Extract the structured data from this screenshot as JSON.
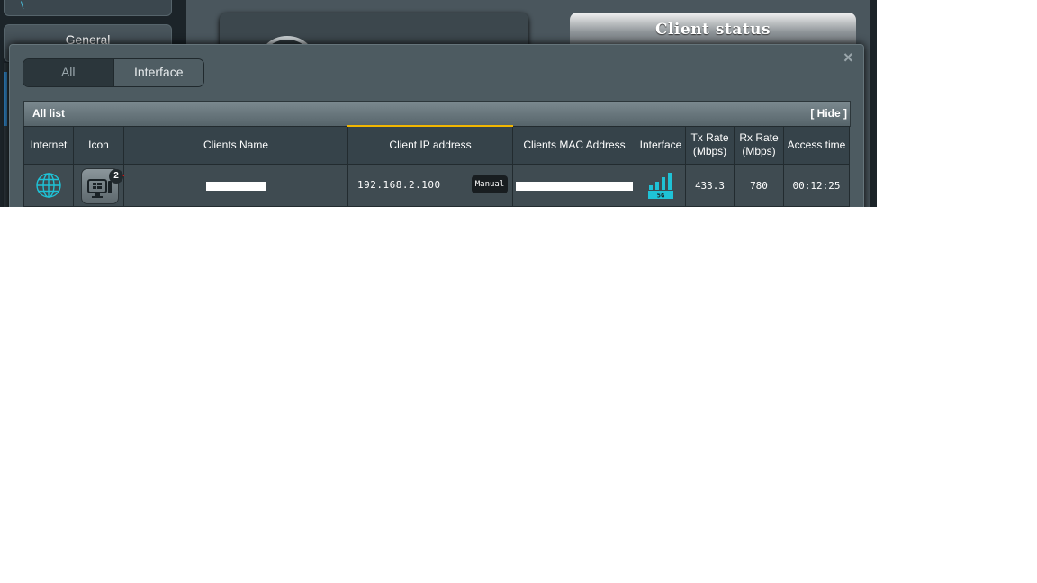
{
  "sidebar": {
    "general_label": "General"
  },
  "panel": {
    "client_status_title": "Client status"
  },
  "modal": {
    "close_glyph": "×",
    "tabs": [
      {
        "label": "All",
        "active": false
      },
      {
        "label": "Interface",
        "active": true
      }
    ],
    "list": {
      "title": "All list",
      "hide_label": "[ Hide ]",
      "columns": [
        "Internet",
        "Icon",
        "Clients Name",
        "Client IP address",
        "Clients MAC Address",
        "Interface",
        "Tx Rate (Mbps)",
        "Rx Rate (Mbps)",
        "Access time"
      ],
      "sorted_column": "Client IP address",
      "rows": [
        {
          "internet_icon": "globe-icon",
          "device_icon": "windows-desktop-icon",
          "device_badge": "2",
          "client_name": "",
          "ip": "192.168.2.100",
          "ip_mode": "Manual",
          "mac": "",
          "interface_band": "5G",
          "interface_icon": "wifi-signal-icon",
          "tx_rate": "433.3",
          "rx_rate": "780",
          "access_time": "00:12:25"
        }
      ]
    }
  },
  "colors": {
    "accent_cyan": "#1fc2d6",
    "sort_highlight": "#f2b600",
    "annotation_red": "#e01010"
  }
}
